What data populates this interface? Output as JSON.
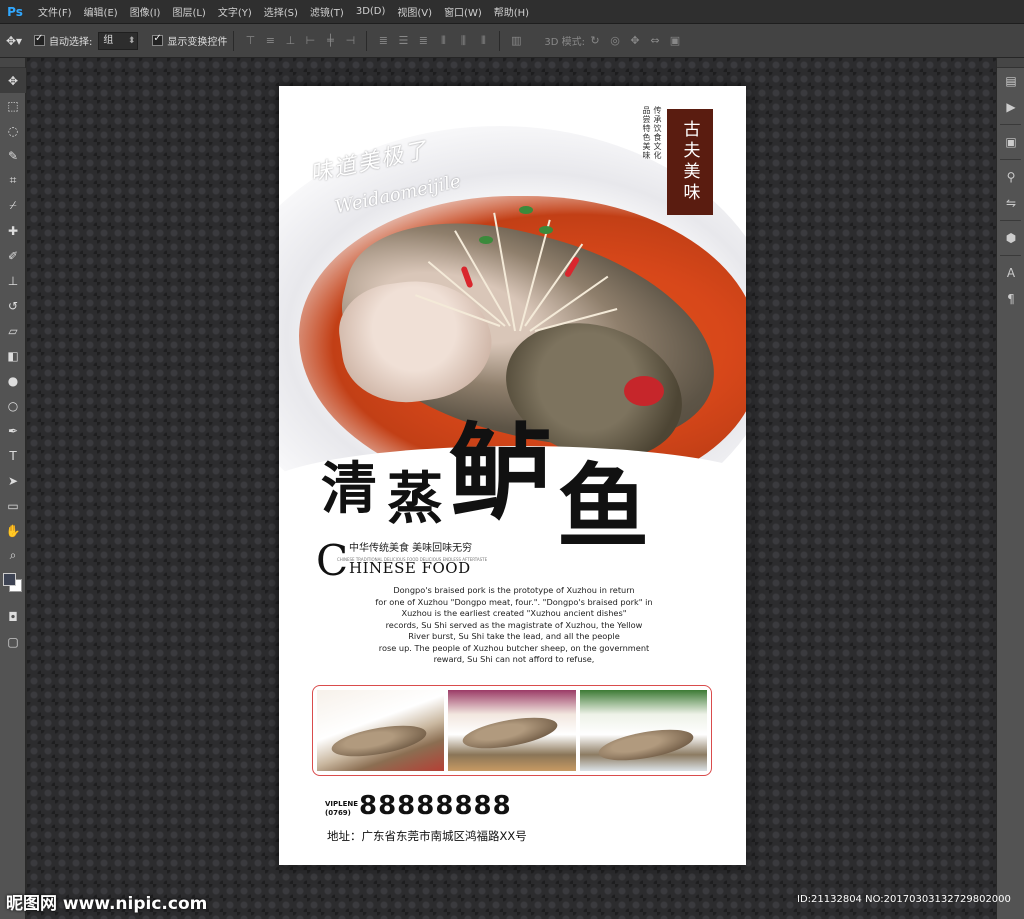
{
  "app": {
    "logo": "Ps",
    "menu": [
      "文件(F)",
      "编辑(E)",
      "图像(I)",
      "图层(L)",
      "文字(Y)",
      "选择(S)",
      "滤镜(T)",
      "3D(D)",
      "视图(V)",
      "窗口(W)",
      "帮助(H)"
    ]
  },
  "options_bar": {
    "auto_select_label": "自动选择:",
    "auto_select_value": "组",
    "show_transform_label": "显示变换控件",
    "mode_3d_label": "3D 模式:"
  },
  "tools": [
    "move-tool",
    "marquee-tool",
    "lasso-tool",
    "quick-select-tool",
    "crop-tool",
    "eyedropper-tool",
    "healing-tool",
    "brush-tool",
    "stamp-tool",
    "history-brush-tool",
    "eraser-tool",
    "gradient-tool",
    "blur-tool",
    "dodge-tool",
    "pen-tool",
    "type-tool",
    "path-select-tool",
    "shape-tool",
    "hand-tool",
    "zoom-tool"
  ],
  "colors": {
    "foreground": "#3d4353",
    "background": "#ffffff",
    "accent": "#31a8ff",
    "poster_red": "#d94c4c",
    "stamp_brown": "#5a1c10"
  },
  "poster": {
    "calligraphy": "味道美极了",
    "pinyin": "Weidaomeijile",
    "stamp": "古夫美味",
    "vertical_text_1": "传承饮食文化",
    "vertical_text_2": "品尝特色美味",
    "title_chars": [
      "清",
      "蒸",
      "鲈",
      "鱼"
    ],
    "small_en": "CHINESE TRADITIONAL DELICIOUS FOOD DELICIOUS ENDLESS AFTERTASTE",
    "subtitle_cn": "中华传统美食  美味回味无穷",
    "c_big": "C",
    "chinese_food": "HINESE FOOD",
    "description": [
      "Dongpo's braised pork is the prototype of Xuzhou in return",
      "for one of Xuzhou \"Dongpo meat, four.\". \"Dongpo's braised pork\" in",
      "Xuzhou is the earliest created \"Xuzhou ancient dishes\"",
      "records, Su Shi served as the magistrate of Xuzhou, the Yellow",
      "River burst, Su Shi take the lead, and all the people",
      "rose up. The people of Xuzhou butcher sheep, on the government",
      "reward, Su Shi can not afford to refuse,"
    ],
    "viplene": "VIPLENE",
    "area_code": "(0769)",
    "phone": "88888888",
    "address": "地址：广东省东莞市南城区鸿福路XX号"
  },
  "footer": {
    "watermark": "昵图网 www.nipic.com",
    "image_id": "ID:21132804 NO:20170303132729802000"
  }
}
